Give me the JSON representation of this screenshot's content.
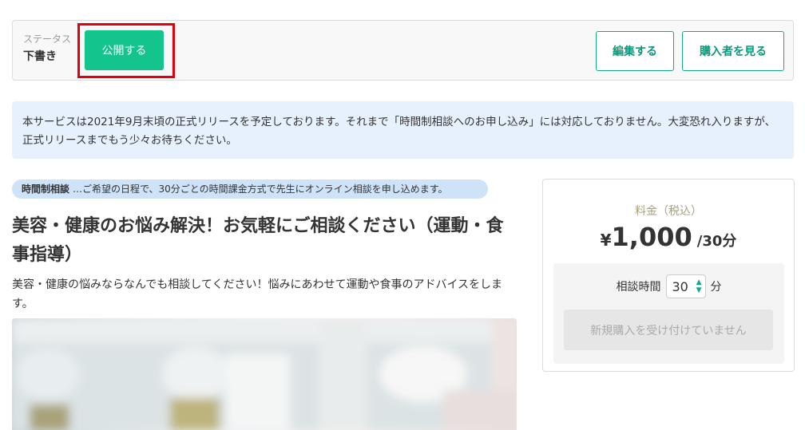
{
  "status": {
    "label": "ステータス",
    "value": "下書き",
    "publish_label": "公開する",
    "edit_label": "編集する",
    "buyers_label": "購入者を見る"
  },
  "notice": {
    "text": "本サービスは2021年9月末頃の正式リリースを予定しております。それまで「時間制相談へのお申し込み」には対応しておりません。大変恐れ入りますが、正式リリースまでもう少々お待ちください。"
  },
  "listing": {
    "type_label": "時間制相談",
    "type_description": "…ご希望の日程で、30分ごとの時間課金方式で先生にオンライン相談を申し込めます。",
    "title": "美容・健康のお悩み解決！お気軽にご相談ください（運動・食事指導）",
    "description": "美容・健康の悩みならなんでも相談してください！悩みにあわせて運動や食事のアドバイスをします。"
  },
  "pricing": {
    "label": "料金（税込）",
    "currency": "¥",
    "amount": "1,000",
    "unit": "/30分",
    "duration_label": "相談時間",
    "duration_value": "30",
    "duration_unit": "分",
    "closed_label": "新規購入を受け付けていません"
  },
  "colors": {
    "accent": "#13c48c",
    "highlight": "#e3000f",
    "notice_background": "#e7f1fd"
  },
  "icons": {
    "stepper": "up-down-arrows-icon"
  }
}
